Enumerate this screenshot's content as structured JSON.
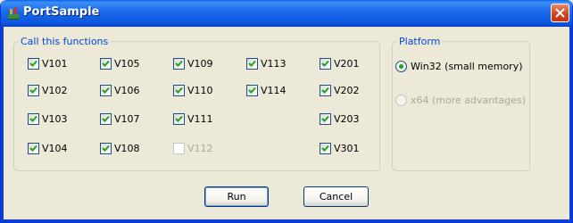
{
  "window": {
    "title": "PortSample"
  },
  "functions_group": {
    "legend": "Call this functions",
    "items": [
      {
        "label": "V101",
        "checked": true,
        "enabled": true
      },
      {
        "label": "V102",
        "checked": true,
        "enabled": true
      },
      {
        "label": "V103",
        "checked": true,
        "enabled": true
      },
      {
        "label": "V104",
        "checked": true,
        "enabled": true
      },
      {
        "label": "V105",
        "checked": true,
        "enabled": true
      },
      {
        "label": "V106",
        "checked": true,
        "enabled": true
      },
      {
        "label": "V107",
        "checked": true,
        "enabled": true
      },
      {
        "label": "V108",
        "checked": true,
        "enabled": true
      },
      {
        "label": "V109",
        "checked": true,
        "enabled": true
      },
      {
        "label": "V110",
        "checked": true,
        "enabled": true
      },
      {
        "label": "V111",
        "checked": true,
        "enabled": true
      },
      {
        "label": "V112",
        "checked": false,
        "enabled": false
      },
      {
        "label": "V113",
        "checked": true,
        "enabled": true
      },
      {
        "label": "V114",
        "checked": true,
        "enabled": true
      },
      {
        "label": "V201",
        "checked": true,
        "enabled": true
      },
      {
        "label": "V202",
        "checked": true,
        "enabled": true
      },
      {
        "label": "V203",
        "checked": true,
        "enabled": true
      },
      {
        "label": "V301",
        "checked": true,
        "enabled": true
      }
    ]
  },
  "platform_group": {
    "legend": "Platform",
    "options": [
      {
        "label": "Win32 (small memory)",
        "selected": true,
        "enabled": true
      },
      {
        "label": "x64 (more advantages)",
        "selected": false,
        "enabled": false
      }
    ]
  },
  "buttons": {
    "run": "Run",
    "cancel": "Cancel"
  },
  "colors": {
    "titlebar": "#0b55dd",
    "legend": "#0046d5",
    "check": "#21a121",
    "disabled_text": "#aca899"
  }
}
